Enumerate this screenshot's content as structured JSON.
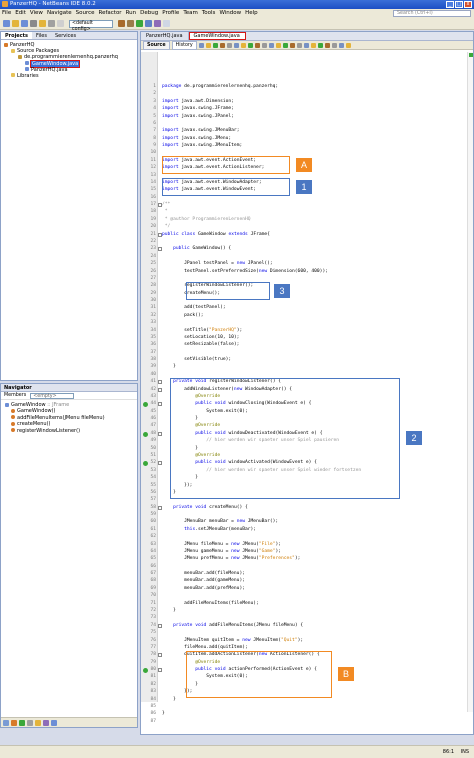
{
  "window": {
    "title": "PanzerHQ - NetBeans IDE 8.0.2",
    "buttons": [
      "_",
      "□",
      "x"
    ]
  },
  "menu": {
    "items": [
      "File",
      "Edit",
      "View",
      "Navigate",
      "Source",
      "Refactor",
      "Run",
      "Debug",
      "Profile",
      "Team",
      "Tools",
      "Window",
      "Help"
    ],
    "search_placeholder": "Search (Ctrl+I)"
  },
  "toolbar": {
    "config": "<default config>"
  },
  "projects_panel": {
    "tabs": [
      "Projects",
      "Files",
      "Services"
    ],
    "tree": [
      {
        "label": "PanzerHQ",
        "depth": 0,
        "icon": "project-icon",
        "color": "#d77a2a"
      },
      {
        "label": "Source Packages",
        "depth": 1,
        "icon": "folder-icon",
        "color": "#e8c356"
      },
      {
        "label": "de.programmierenlernenhq.panzerhq",
        "depth": 2,
        "icon": "package-icon",
        "color": "#c29a3a"
      },
      {
        "label": "GameWindow.java",
        "depth": 3,
        "icon": "java-file-icon",
        "color": "#6c8ed6",
        "selected": true
      },
      {
        "label": "PanzerHQ.java",
        "depth": 3,
        "icon": "java-file-icon",
        "color": "#6c8ed6"
      },
      {
        "label": "Libraries",
        "depth": 1,
        "icon": "library-icon",
        "color": "#e8c356"
      }
    ]
  },
  "navigator": {
    "title": "Navigator",
    "members_label": "Members",
    "filter": "<empty>",
    "members": [
      {
        "label": "GameWindow",
        "sub": " :: JFrame",
        "depth": 0,
        "icon": "class-icon"
      },
      {
        "label": "GameWindow()",
        "sub": "",
        "depth": 1,
        "icon": "constructor-icon"
      },
      {
        "label": "addFileMenuItems(JMenu fileMenu)",
        "sub": "",
        "depth": 1,
        "icon": "method-icon"
      },
      {
        "label": "createMenu()",
        "sub": "",
        "depth": 1,
        "icon": "method-icon"
      },
      {
        "label": "registerWindowListener()",
        "sub": "",
        "depth": 1,
        "icon": "method-icon"
      }
    ]
  },
  "editor": {
    "tabs": [
      "PanzerHQ.java",
      "GameWindow.java"
    ],
    "active_tab": "GameWindow.java",
    "modes": [
      "Source",
      "History"
    ],
    "active_mode": "Source",
    "lines": [
      {
        "n": "1",
        "t": "package de.programmierenlernenhq.panzerhq;"
      },
      {
        "n": "2",
        "t": ""
      },
      {
        "n": "3",
        "t": "import java.awt.Dimension;"
      },
      {
        "n": "4",
        "t": "import javax.swing.JFrame;"
      },
      {
        "n": "5",
        "t": "import javax.swing.JPanel;"
      },
      {
        "n": "6",
        "t": ""
      },
      {
        "n": "7",
        "t": "import javax.swing.JMenuBar;"
      },
      {
        "n": "8",
        "t": "import javax.swing.JMenu;"
      },
      {
        "n": "9",
        "t": "import javax.swing.JMenuItem;"
      },
      {
        "n": "10",
        "t": ""
      },
      {
        "n": "11",
        "t": "import java.awt.event.ActionEvent;"
      },
      {
        "n": "12",
        "t": "import java.awt.event.ActionListener;"
      },
      {
        "n": "13",
        "t": ""
      },
      {
        "n": "14",
        "t": "import java.awt.event.WindowAdapter;"
      },
      {
        "n": "15",
        "t": "import java.awt.event.WindowEvent;"
      },
      {
        "n": "16",
        "t": ""
      },
      {
        "n": "17",
        "t": "/**"
      },
      {
        "n": "18",
        "t": " *"
      },
      {
        "n": "19",
        "t": " * @author ProgrammierenLernenHQ"
      },
      {
        "n": "20",
        "t": " */"
      },
      {
        "n": "21",
        "t": "public class GameWindow extends JFrame{"
      },
      {
        "n": "22",
        "t": ""
      },
      {
        "n": "23",
        "t": "    public GameWindow() {"
      },
      {
        "n": "24",
        "t": ""
      },
      {
        "n": "25",
        "t": "        JPanel testPanel = new JPanel();"
      },
      {
        "n": "26",
        "t": "        testPanel.setPreferredSize(new Dimension(600, 400));"
      },
      {
        "n": "27",
        "t": ""
      },
      {
        "n": "28",
        "t": "        registerWindowListener();"
      },
      {
        "n": "29",
        "t": "        createMenu();"
      },
      {
        "n": "30",
        "t": ""
      },
      {
        "n": "31",
        "t": "        add(testPanel);"
      },
      {
        "n": "32",
        "t": "        pack();"
      },
      {
        "n": "33",
        "t": ""
      },
      {
        "n": "34",
        "t": "        setTitle(\"PanzerHQ\");"
      },
      {
        "n": "35",
        "t": "        setLocation(10, 10);"
      },
      {
        "n": "36",
        "t": "        setResizable(false);"
      },
      {
        "n": "37",
        "t": ""
      },
      {
        "n": "38",
        "t": "        setVisible(true);"
      },
      {
        "n": "39",
        "t": "    }"
      },
      {
        "n": "40",
        "t": ""
      },
      {
        "n": "41",
        "t": "    private void registerWindowListener() {"
      },
      {
        "n": "42",
        "t": "        addWindowListener(new WindowAdapter() {"
      },
      {
        "n": "43",
        "t": "            @Override"
      },
      {
        "n": "44",
        "t": "            public void windowClosing(WindowEvent e) {"
      },
      {
        "n": "45",
        "t": "                System.exit(0);"
      },
      {
        "n": "46",
        "t": "            }"
      },
      {
        "n": "47",
        "t": "            @Override"
      },
      {
        "n": "48",
        "t": "            public void windowDeactivated(WindowEvent e) {"
      },
      {
        "n": "49",
        "t": "                // hier werden wir spaeter unser Spiel pausieren"
      },
      {
        "n": "50",
        "t": "            }"
      },
      {
        "n": "51",
        "t": "            @Override"
      },
      {
        "n": "52",
        "t": "            public void windowActivated(WindowEvent e) {"
      },
      {
        "n": "53",
        "t": "                // hier werden wir spaeter unser Spiel wieder fortsetzen"
      },
      {
        "n": "54",
        "t": "            }"
      },
      {
        "n": "55",
        "t": "        });"
      },
      {
        "n": "56",
        "t": "    }"
      },
      {
        "n": "57",
        "t": ""
      },
      {
        "n": "58",
        "t": "    private void createMenu() {"
      },
      {
        "n": "59",
        "t": ""
      },
      {
        "n": "60",
        "t": "        JMenuBar menuBar = new JMenuBar();"
      },
      {
        "n": "61",
        "t": "        this.setJMenuBar(menuBar);"
      },
      {
        "n": "62",
        "t": ""
      },
      {
        "n": "63",
        "t": "        JMenu fileMenu = new JMenu(\"File\");"
      },
      {
        "n": "64",
        "t": "        JMenu gameMenu = new JMenu(\"Game\");"
      },
      {
        "n": "65",
        "t": "        JMenu prefMenu = new JMenu(\"Preferences\");"
      },
      {
        "n": "66",
        "t": ""
      },
      {
        "n": "67",
        "t": "        menuBar.add(fileMenu);"
      },
      {
        "n": "68",
        "t": "        menuBar.add(gameMenu);"
      },
      {
        "n": "69",
        "t": "        menuBar.add(prefMenu);"
      },
      {
        "n": "70",
        "t": ""
      },
      {
        "n": "71",
        "t": "        addFileMenuItems(fileMenu);"
      },
      {
        "n": "72",
        "t": "    }"
      },
      {
        "n": "73",
        "t": ""
      },
      {
        "n": "74",
        "t": "    private void addFileMenuItems(JMenu fileMenu) {"
      },
      {
        "n": "75",
        "t": ""
      },
      {
        "n": "76",
        "t": "        JMenuItem quitItem = new JMenuItem(\"Quit\");"
      },
      {
        "n": "77",
        "t": "        fileMenu.add(quitItem);"
      },
      {
        "n": "78",
        "t": "        quitItem.addActionListener(new ActionListener() {"
      },
      {
        "n": "79",
        "t": "            @Override"
      },
      {
        "n": "80",
        "t": "            public void actionPerformed(ActionEvent e) {"
      },
      {
        "n": "81",
        "t": "                System.exit(0);"
      },
      {
        "n": "82",
        "t": "            }"
      },
      {
        "n": "83",
        "t": "        });"
      },
      {
        "n": "84",
        "t": "    }"
      },
      {
        "n": "85",
        "t": ""
      },
      {
        "n": "86",
        "t": "}"
      },
      {
        "n": "87",
        "t": ""
      }
    ],
    "override_marker_lines": [
      44,
      48,
      52,
      80
    ]
  },
  "callouts": [
    {
      "label": "A",
      "color": "#f28a23"
    },
    {
      "label": "1",
      "color": "#4a77c2"
    },
    {
      "label": "3",
      "color": "#4a77c2"
    },
    {
      "label": "2",
      "color": "#4a77c2"
    },
    {
      "label": "B",
      "color": "#f28a23"
    }
  ],
  "statusbar": {
    "position": "86:1",
    "mode": "INS"
  }
}
